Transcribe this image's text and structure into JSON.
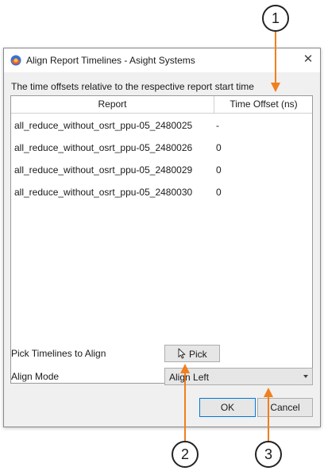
{
  "window": {
    "title": "Align Report Timelines - Asight Systems",
    "close_glyph": "✕",
    "app_icon": "app-logo-icon"
  },
  "caption": "The time offsets relative to the respective report start time",
  "table": {
    "columns": [
      "Report",
      "Time Offset (ns)"
    ],
    "rows": [
      {
        "report": "all_reduce_without_osrt_ppu-05_2480025",
        "offset": "-"
      },
      {
        "report": "all_reduce_without_osrt_ppu-05_2480026",
        "offset": "0"
      },
      {
        "report": "all_reduce_without_osrt_ppu-05_2480029",
        "offset": "0"
      },
      {
        "report": "all_reduce_without_osrt_ppu-05_2480030",
        "offset": "0"
      }
    ]
  },
  "pick": {
    "label": "Pick Timelines to Align",
    "button_label": "Pick",
    "icon": "cursor-arrow-icon"
  },
  "align_mode": {
    "label": "Align Mode",
    "selected": "Align Left"
  },
  "buttons": {
    "ok": "OK",
    "cancel": "Cancel"
  },
  "callouts": [
    "1",
    "2",
    "3"
  ],
  "colors": {
    "annotation": "#f07f1e",
    "ok_focus": "#0078d7"
  }
}
